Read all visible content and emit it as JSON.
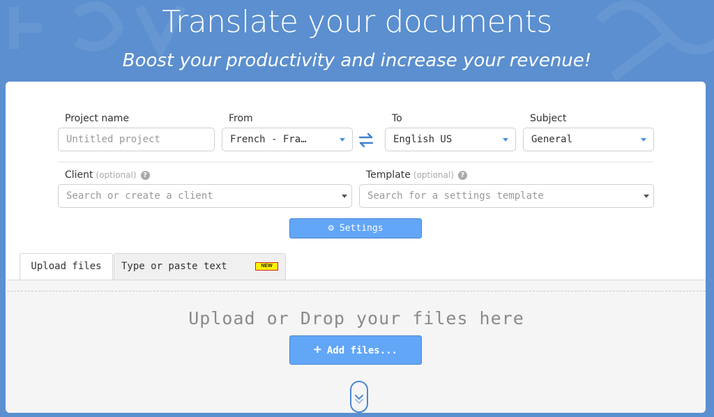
{
  "hero": {
    "title": "Translate your documents",
    "subtitle": "Boost your productivity and increase your revenue!"
  },
  "form": {
    "project_name": {
      "label": "Project name",
      "placeholder": "Untitled project",
      "value": ""
    },
    "from": {
      "label": "From",
      "value": "French - Fra…"
    },
    "to": {
      "label": "To",
      "value": "English US"
    },
    "subject": {
      "label": "Subject",
      "value": "General"
    },
    "client": {
      "label": "Client",
      "optional": "(optional)",
      "placeholder": "Search or create a client"
    },
    "template": {
      "label": "Template",
      "optional": "(optional)",
      "placeholder": "Search for a settings template"
    },
    "help_glyph": "?",
    "settings_label": "Settings"
  },
  "tabs": [
    {
      "label": "Upload files",
      "active": true
    },
    {
      "label": "Type or paste text",
      "active": false,
      "badge": "NEW"
    }
  ],
  "upload": {
    "drop_text": "Upload or Drop your files here",
    "add_label": "Add files..."
  },
  "colors": {
    "background": "#5b8fcf",
    "accent": "#62a6f7",
    "select_caret": "#4a90e2",
    "badge_bg": "#fff200",
    "badge_border": "#d42020"
  },
  "icons": [
    "gear-icon",
    "swap-arrows-icon",
    "plus-icon",
    "chevron-down-icon",
    "help-icon",
    "caret-down-icon"
  ]
}
